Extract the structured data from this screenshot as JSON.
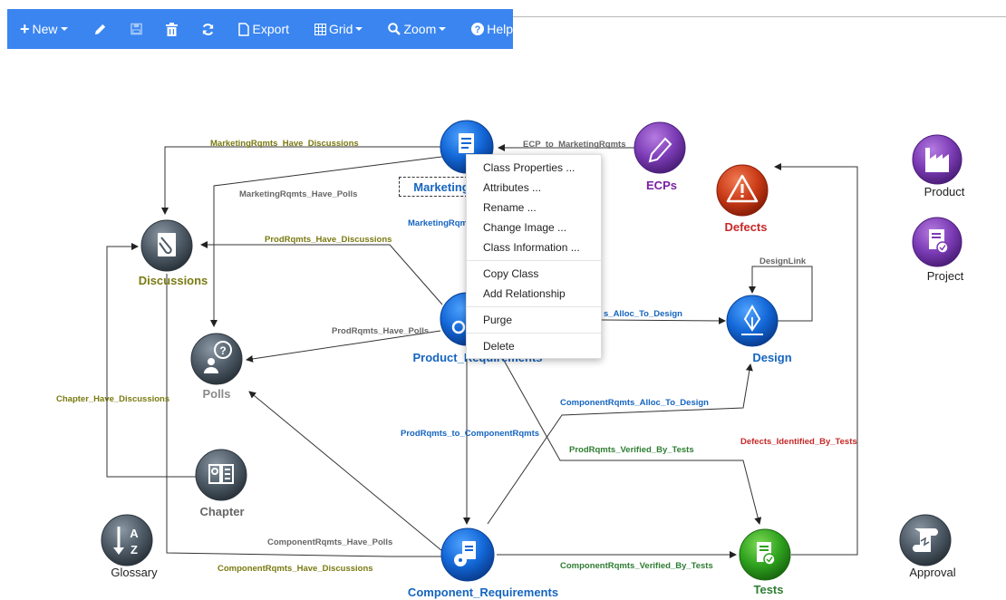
{
  "toolbar": {
    "new_label": "New",
    "export_label": "Export",
    "grid_label": "Grid",
    "zoom_label": "Zoom",
    "help_label": "Help"
  },
  "nodes": {
    "marketing": {
      "label": "Marketing",
      "color": "#1565c0"
    },
    "ecps": {
      "label": "ECPs",
      "color": "#7b1fa2"
    },
    "defects": {
      "label": "Defects",
      "color": "#c62828"
    },
    "product_top": {
      "label": "Product"
    },
    "project": {
      "label": "Project"
    },
    "discussions": {
      "label": "Discussions",
      "color": "#7a7a12"
    },
    "polls": {
      "label": "Polls",
      "color": "#8a8a8a"
    },
    "product_requirements": {
      "label": "Product_Requirements",
      "color": "#1565c0"
    },
    "design": {
      "label": "Design",
      "color": "#1565c0"
    },
    "chapter": {
      "label": "Chapter",
      "color": "#666666"
    },
    "glossary": {
      "label": "Glossary"
    },
    "component_requirements": {
      "label": "Component_Requirements",
      "color": "#1565c0"
    },
    "tests": {
      "label": "Tests",
      "color": "#2e7d32"
    },
    "approval": {
      "label": "Approval"
    }
  },
  "edges": {
    "mkt_disc": "MarketingRqmts_Have_Discussions",
    "ecp_mkt": "ECP_to_MarketingRqmts",
    "mkt_polls": "MarketingRqmts_Have_Polls",
    "mkt_prod": "MarketingRqm",
    "prod_disc": "ProdRqmts_Have_Discussions",
    "prod_polls": "ProdRqmts_Have_Polls",
    "prod_design": "s_Alloc_To_Design",
    "design_loop": "DesignLink",
    "chap_disc": "Chapter_Have_Discussions",
    "prod_comp": "ProdRqmts_to_ComponentRqmts",
    "comp_design": "ComponentRqmts_Alloc_To_Design",
    "prod_tests": "ProdRqmts_Verified_By_Tests",
    "defects_tests": "Defects_Identified_By_Tests",
    "comp_polls": "ComponentRqmts_Have_Polls",
    "comp_disc": "ComponentRqmts_Have_Discussions",
    "comp_tests": "ComponentRqmts_Verified_By_Tests"
  },
  "context_menu": {
    "items": [
      "Class Properties ...",
      "Attributes ...",
      "Rename ...",
      "Change Image ...",
      "Class Information ...",
      "Copy Class",
      "Add Relationship",
      "Purge",
      "Delete"
    ]
  },
  "colors": {
    "toolbar": "#3a85f0",
    "blue_node": "#1565c0",
    "purple_node": "#6a1b9a",
    "red_node": "#c62828",
    "gray_node": "#4a5560",
    "green_node": "#2e9d22",
    "olive_edge": "#7a7a12",
    "blue_edge": "#1565c0",
    "green_edge": "#2e7d32",
    "red_edge": "#c62828",
    "gray_edge": "#666666"
  }
}
